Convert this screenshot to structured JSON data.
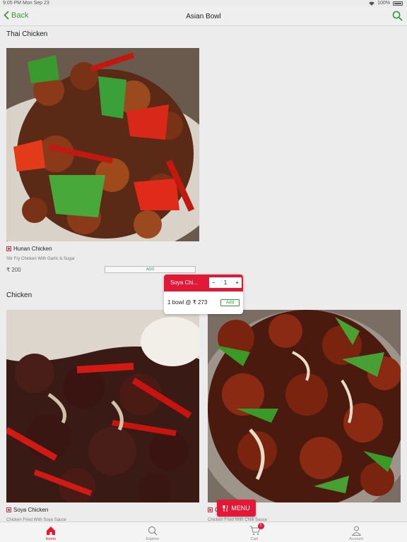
{
  "status_bar": {
    "time": "9:05 PM   Mon Sep 23",
    "battery": "100%"
  },
  "navbar": {
    "back_label": "Back",
    "title": "Asian Bowl"
  },
  "sections": [
    {
      "title": "Thai Chicken",
      "items": [
        {
          "name": "Hunan Chicken",
          "description": "Stir Fry Chicken With Garlic & Sugar",
          "price": "₹ 200",
          "add_label": "ADD"
        }
      ]
    },
    {
      "title": "Chicken",
      "items": [
        {
          "name": "Soya Chicken",
          "description": "Chicken Fried With Soya Sauce"
        },
        {
          "name": "C",
          "description": "Chicken Fried With Chilli Sauce"
        }
      ]
    }
  ],
  "popup": {
    "title": "Soya Chi...",
    "minus": "−",
    "quantity": "1",
    "plus": "+",
    "line": "1 bowl @ ₹ 273",
    "add_label": "Add"
  },
  "menu_fab": {
    "label": "MENU",
    "icon": "utensils-icon"
  },
  "tabbar": {
    "tabs": [
      {
        "label": "Home",
        "icon": "home-icon",
        "active": true
      },
      {
        "label": "Explore",
        "icon": "search-icon"
      },
      {
        "label": "Cart",
        "icon": "cart-icon",
        "badge": "1"
      },
      {
        "label": "Account",
        "icon": "user-icon"
      }
    ]
  },
  "colors": {
    "accent": "#e31837",
    "green": "#3a9a3a"
  }
}
